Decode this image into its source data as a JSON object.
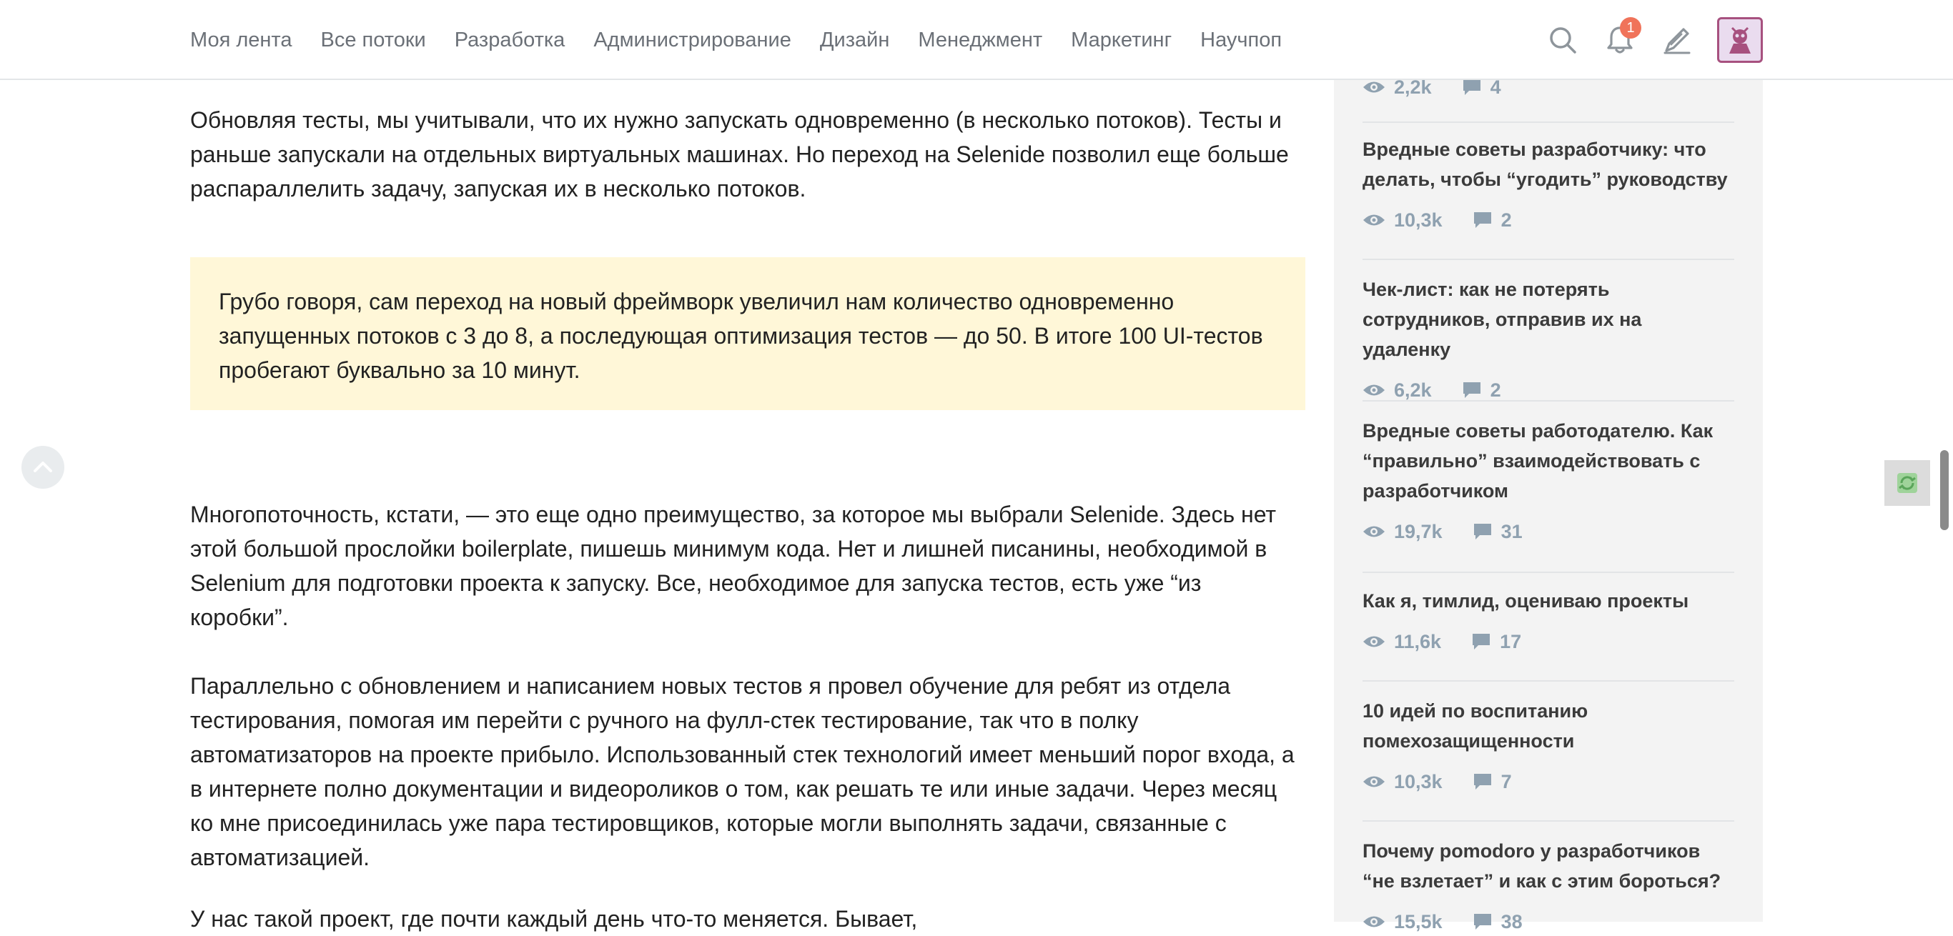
{
  "nav": {
    "items": [
      "Моя лента",
      "Все потоки",
      "Разработка",
      "Администрирование",
      "Дизайн",
      "Менеджмент",
      "Маркетинг",
      "Научпоп"
    ]
  },
  "header": {
    "notifications_count": "1"
  },
  "article": {
    "p1": "Обновляя тесты, мы учитывали, что их нужно запускать одновременно (в несколько потоков). Тесты и раньше запускали на отдельных виртуальных машинах. Но переход на Selenide позволил еще больше распараллелить задачу, запуская их в несколько потоков.",
    "callout": "Грубо говоря, сам переход на новый фреймворк увеличил нам количество одновременно запущенных потоков с 3 до 8, а последующая оптимизация тестов — до 50. В итоге 100 UI-тестов пробегают буквально за 10 минут.",
    "p2": "Многопоточность, кстати, — это еще одно преимущество, за которое мы выбрали Selenide. Здесь нет этой большой прослойки boilerplate, пишешь минимум кода. Нет и лишней писанины, необходимой в Selenium для подготовки проекта к запуску. Все, необходимое для запуска тестов, есть уже “из коробки”.",
    "p3": "Параллельно с обновлением и написанием новых тестов я провел обучение для ребят из отдела тестирования, помогая им перейти с ручного на фулл-стек тестирование, так что в полку автоматизаторов на проекте прибыло. Использованный стек технологий имеет меньший порог входа, а в интернете полно документации и видеороликов о том, как решать те или иные задачи. Через месяц ко мне присоединилась уже пара тестировщиков, которые могли выполнять задачи, связанные с автоматизацией.",
    "p4": "У нас такой проект, где почти каждый день что-то меняется. Бывает,"
  },
  "sidebar": {
    "partial": {
      "views": "2,2k",
      "comments": "4"
    },
    "items": [
      {
        "title": "Вредные советы разработчику: что делать, чтобы “угодить” руководству",
        "views": "10,3k",
        "comments": "2"
      },
      {
        "title": "Чек-лист: как не потерять сотрудников, отправив их на удаленку",
        "views": "6,2k",
        "comments": "2"
      },
      {
        "title": "Вредные советы работодателю. Как “правильно” взаимодействовать с разработчиком",
        "views": "19,7k",
        "comments": "31"
      },
      {
        "title": "Как я, тимлид, оцениваю проекты",
        "views": "11,6k",
        "comments": "17"
      },
      {
        "title": "10 идей по воспитанию помехозащищенности",
        "views": "10,3k",
        "comments": "7"
      },
      {
        "title": "Почему pomodoro у разработчиков “не взлетает” и как с этим бороться?",
        "views": "15,5k",
        "comments": "38"
      }
    ]
  },
  "colors": {
    "callout_bg": "#fff7d8",
    "badge": "#f0735a",
    "stat": "#8fa1b0",
    "avatar_border": "#a7517f"
  },
  "icons": [
    "search-icon",
    "bell-icon",
    "pen-icon",
    "avatar",
    "eye-icon",
    "comment-icon",
    "chevron-up-icon",
    "sync-icon"
  ]
}
